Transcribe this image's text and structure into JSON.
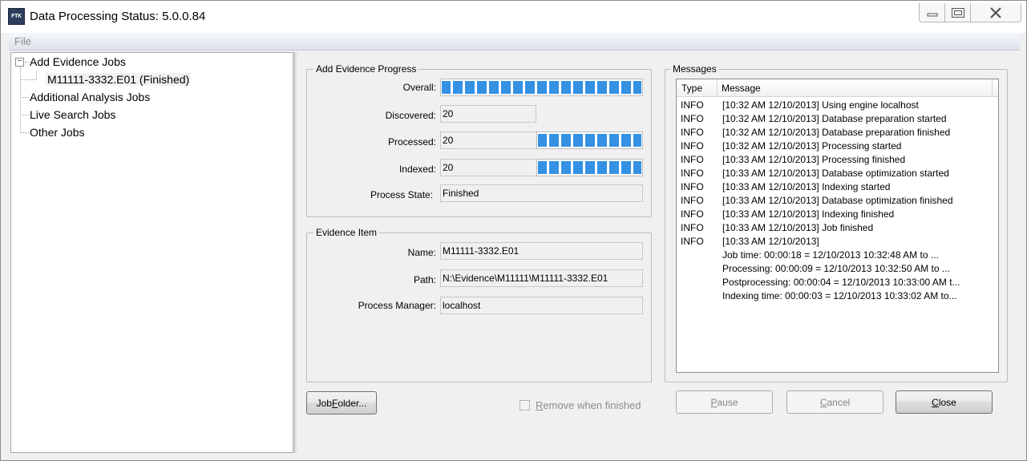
{
  "window": {
    "title": "Data Processing Status: 5.0.0.84",
    "app_icon_text": "FTK"
  },
  "menu": [
    "File"
  ],
  "tree": {
    "items": [
      {
        "label": "Add Evidence Jobs",
        "children": [
          {
            "label": "M11111-3332.E01 (Finished)"
          }
        ]
      },
      {
        "label": "Additional Analysis Jobs"
      },
      {
        "label": "Live Search Jobs"
      },
      {
        "label": "Other Jobs"
      }
    ]
  },
  "progress_group": {
    "title": "Add Evidence Progress",
    "overall_label": "Overall:",
    "overall_progress": 1.0,
    "discovered_label": "Discovered:",
    "discovered_value": "20",
    "processed_label": "Processed:",
    "processed_value": "20",
    "processed_progress": 1.0,
    "indexed_label": "Indexed:",
    "indexed_value": "20",
    "indexed_progress": 1.0,
    "state_label": "Process State:",
    "state_value": "Finished"
  },
  "evidence_group": {
    "title": "Evidence Item",
    "name_label": "Name:",
    "name_value": "M11111-3332.E01",
    "path_label": "Path:",
    "path_value": "N:\\Evidence\\M11111\\M11111-3332.E01",
    "manager_label": "Process Manager:",
    "manager_value": "localhost"
  },
  "messages": {
    "title": "Messages",
    "columns": [
      "Type",
      "Message"
    ],
    "rows": [
      {
        "type": "INFO",
        "text": "[10:32 AM 12/10/2013] Using engine localhost"
      },
      {
        "type": "INFO",
        "text": "[10:32 AM 12/10/2013] Database preparation started"
      },
      {
        "type": "INFO",
        "text": "[10:32 AM 12/10/2013] Database preparation finished"
      },
      {
        "type": "INFO",
        "text": "[10:32 AM 12/10/2013] Processing started"
      },
      {
        "type": "INFO",
        "text": "[10:33 AM 12/10/2013] Processing finished"
      },
      {
        "type": "INFO",
        "text": "[10:33 AM 12/10/2013] Database optimization started"
      },
      {
        "type": "INFO",
        "text": "[10:33 AM 12/10/2013] Indexing started"
      },
      {
        "type": "INFO",
        "text": "[10:33 AM 12/10/2013] Database optimization finished"
      },
      {
        "type": "INFO",
        "text": "[10:33 AM 12/10/2013] Indexing finished"
      },
      {
        "type": "INFO",
        "text": "[10:33 AM 12/10/2013] Job finished"
      },
      {
        "type": "INFO",
        "text": "[10:33 AM 12/10/2013]"
      },
      {
        "type": "",
        "text": "Job time:       00:00:18 = 12/10/2013 10:32:48 AM to ..."
      },
      {
        "type": "",
        "text": "Processing:     00:00:09 = 12/10/2013 10:32:50 AM to ..."
      },
      {
        "type": "",
        "text": "Postprocessing: 00:00:04 = 12/10/2013 10:33:00 AM t..."
      },
      {
        "type": "",
        "text": "Indexing time:  00:00:03 = 12/10/2013 10:33:02 AM to..."
      }
    ]
  },
  "buttons": {
    "job_folder_pre": "Job ",
    "job_folder_u": "F",
    "job_folder_post": "older...",
    "remove_label": "Remove when finished",
    "remove_u": "R",
    "remove_post": "emove when finished",
    "pause_u": "P",
    "pause_post": "ause",
    "cancel_pre": "",
    "cancel_u": "C",
    "cancel_post": "ancel",
    "close_u": "C",
    "close_post": "lose"
  },
  "colors": {
    "progress_fill": "#3591e3",
    "window_bg": "#f0f0f0"
  }
}
